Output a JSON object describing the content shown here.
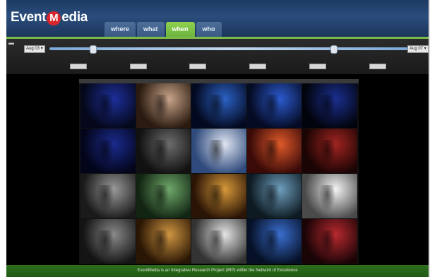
{
  "app": {
    "logo": {
      "text1": "Event",
      "heart": "M",
      "text2": "edia"
    },
    "tabs": [
      {
        "label": "where",
        "active": false
      },
      {
        "label": "what",
        "active": false
      },
      {
        "label": "when",
        "active": true
      },
      {
        "label": "who",
        "active": false
      }
    ]
  },
  "timeline": {
    "collapse_icon": "collapse-icon",
    "start_date": "Aug 03",
    "end_date": "Aug 07",
    "range_fraction": [
      0.12,
      0.79
    ]
  },
  "gallery": {
    "title": "",
    "photos": [
      {
        "c1": "#1d2f9c",
        "c2": "#05081a"
      },
      {
        "c1": "#c9a58a",
        "c2": "#2a1a10"
      },
      {
        "c1": "#2c62c6",
        "c2": "#03091f"
      },
      {
        "c1": "#2b5bd0",
        "c2": "#050b23"
      },
      {
        "c1": "#1b2f90",
        "c2": "#02040d"
      },
      {
        "c1": "#1a2b8e",
        "c2": "#03051a"
      },
      {
        "c1": "#6d6d6d",
        "c2": "#111111"
      },
      {
        "c1": "#e0e6f2",
        "c2": "#2f4a7c"
      },
      {
        "c1": "#e05a2a",
        "c2": "#3a0a08"
      },
      {
        "c1": "#a12420",
        "c2": "#1b0404"
      },
      {
        "c1": "#9a9a9a",
        "c2": "#1a1a1a"
      },
      {
        "c1": "#6fa96b",
        "c2": "#122512"
      },
      {
        "c1": "#d89a3a",
        "c2": "#2a1405"
      },
      {
        "c1": "#6f9fbe",
        "c2": "#0d1a22"
      },
      {
        "c1": "#f5f5f5",
        "c2": "#4a4a4a"
      },
      {
        "c1": "#8a8a8a",
        "c2": "#141414"
      },
      {
        "c1": "#d09642",
        "c2": "#2a1604"
      },
      {
        "c1": "#e6e6e6",
        "c2": "#333333"
      },
      {
        "c1": "#3a6fd0",
        "c2": "#061127"
      },
      {
        "c1": "#b8292f",
        "c2": "#1a0406"
      }
    ]
  },
  "footer": {
    "text_before": "EventMedia is an Integrative Research Project (IRP) within the",
    "link": "",
    "text_after": "Network of Excellence"
  }
}
